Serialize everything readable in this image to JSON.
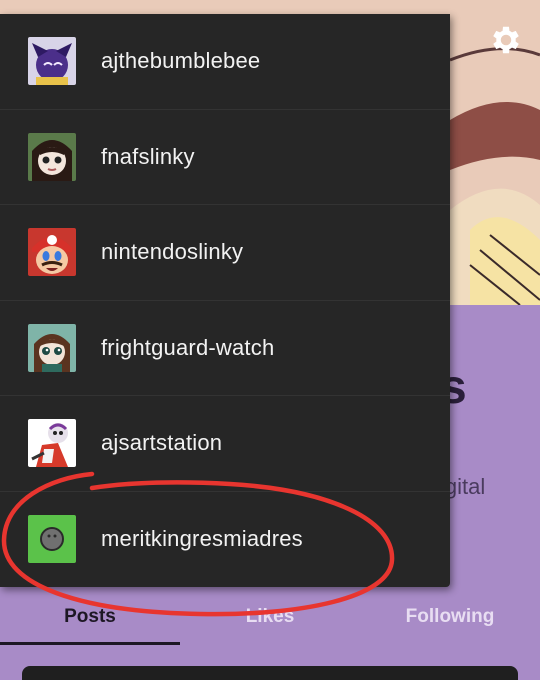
{
  "accounts": [
    {
      "name": "ajthebumblebee",
      "avatar_icon": "purple-character-avatar-icon"
    },
    {
      "name": "fnafslinky",
      "avatar_icon": "dark-hair-character-avatar-icon"
    },
    {
      "name": "nintendoslinky",
      "avatar_icon": "red-cap-character-avatar-icon"
    },
    {
      "name": "frightguard-watch",
      "avatar_icon": "teal-character-avatar-icon"
    },
    {
      "name": "ajsartstation",
      "avatar_icon": "white-character-avatar-icon"
    },
    {
      "name": "meritkingresmiadres",
      "avatar_icon": "green-default-avatar-icon"
    }
  ],
  "tabs": [
    {
      "label": "Posts",
      "active": true
    },
    {
      "label": "Likes",
      "active": false
    },
    {
      "label": "Following",
      "active": false
    }
  ],
  "profile": {
    "title_fragment": "s",
    "description_fragment": "igital"
  },
  "settings_icon": "gear-icon",
  "colors": {
    "dropdown_bg": "#262626",
    "profile_bg": "#a88bc7",
    "annotation": "#e8352f"
  }
}
